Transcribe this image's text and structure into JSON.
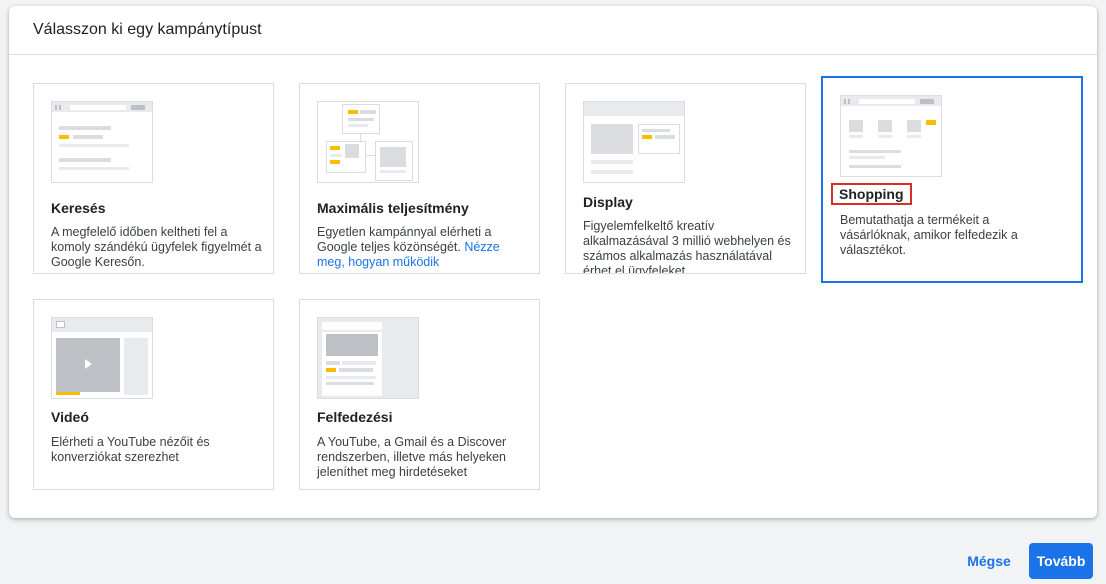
{
  "dialog": {
    "title": "Válasszon ki egy kampánytípust"
  },
  "cards": [
    {
      "title": "Keresés",
      "desc": "A megfelelő időben keltheti fel a komoly szándékú ügyfelek figyelmét a Google Keresőn."
    },
    {
      "title": "Maximális teljesítmény",
      "desc": "Egyetlen kampánnyal elérheti a Google teljes közönségét.",
      "link": "Nézze meg, hogyan működik"
    },
    {
      "title": "Display",
      "desc": "Figyelemfelkeltő kreatív alkalmazásával 3 millió webhelyen és számos alkalmazás használatával érhet el ügyfeleket."
    },
    {
      "title": "Shopping",
      "desc": "Bemutathatja a termékeit a vásárlóknak, amikor felfedezik a választékot.",
      "selected": true
    },
    {
      "title": "Videó",
      "desc": "Elérheti a YouTube nézőit és konverziókat szerezhet"
    },
    {
      "title": "Felfedezési",
      "desc": "A YouTube, a Gmail és a Discover rendszerben, illetve más helyeken jeleníthet meg hirdetéseket"
    }
  ],
  "footer": {
    "cancel_label": "Mégse",
    "next_label": "Tovább"
  },
  "colors": {
    "accent": "#1a73e8",
    "highlight_box": "#d93025",
    "illustration_yellow": "#fbbc04"
  }
}
